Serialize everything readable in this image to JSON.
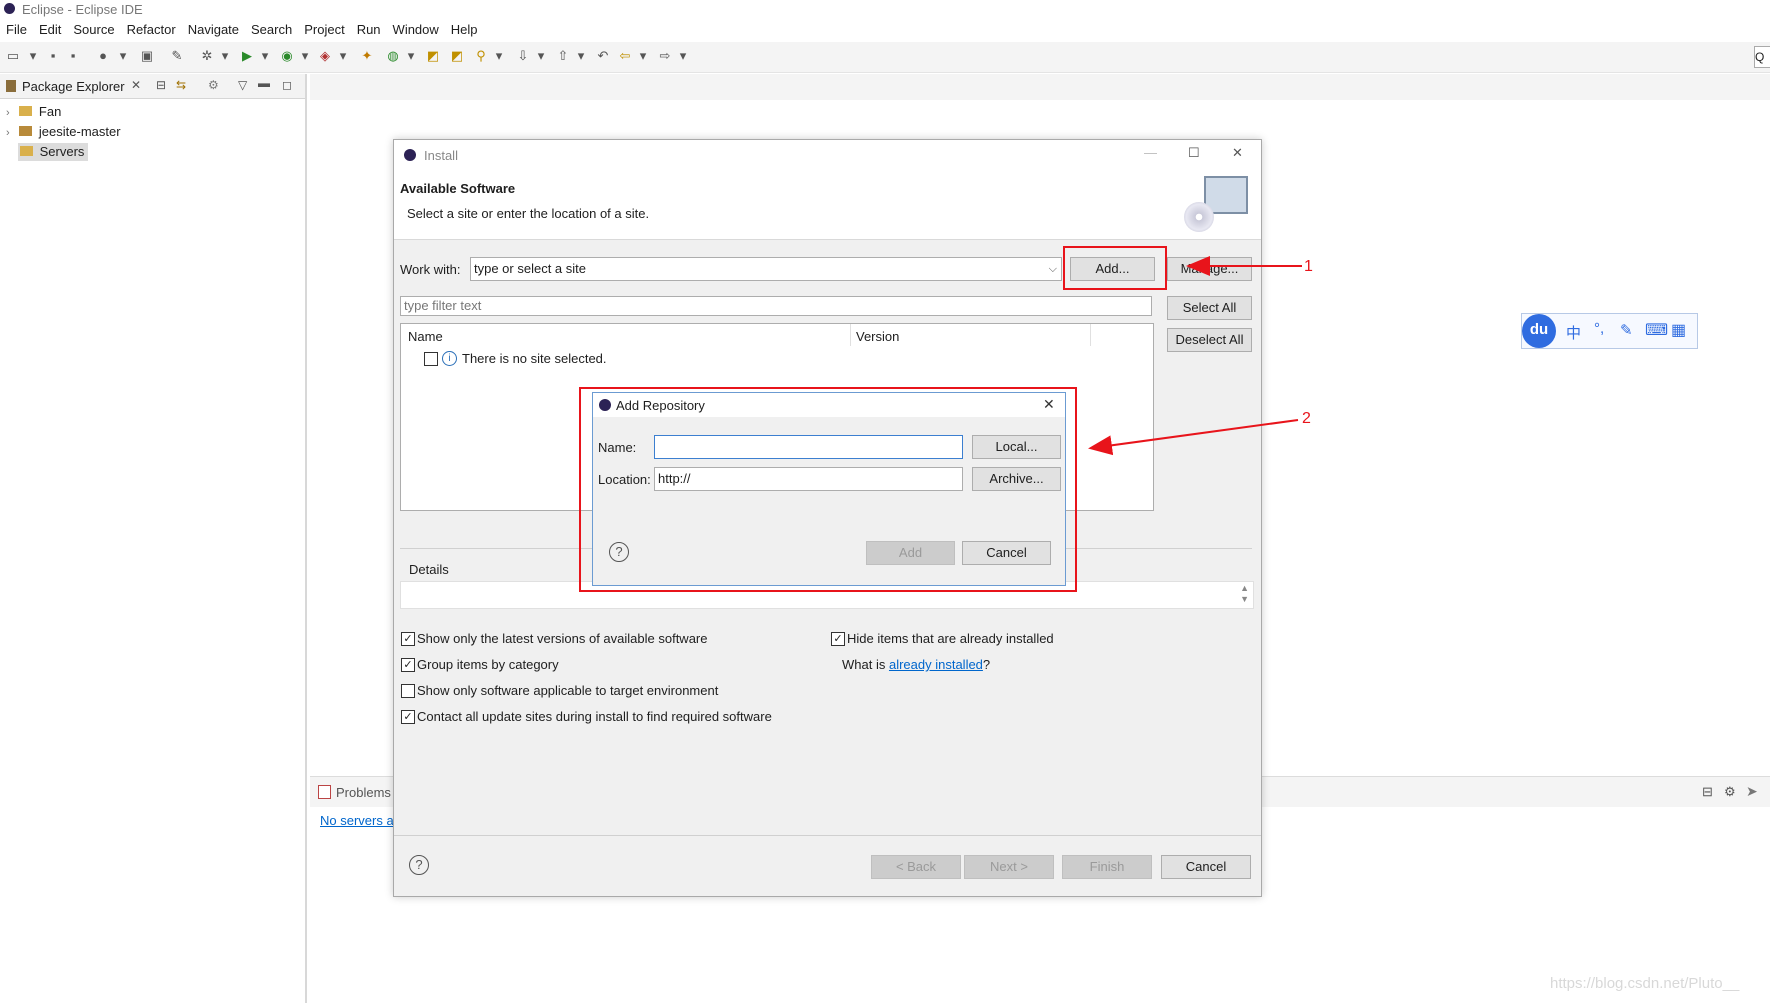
{
  "window": {
    "title": "Eclipse - Eclipse IDE"
  },
  "menu": [
    "File",
    "Edit",
    "Source",
    "Refactor",
    "Navigate",
    "Search",
    "Project",
    "Run",
    "Window",
    "Help"
  ],
  "quick_access": "Q",
  "package_explorer": {
    "tab_label": "Package Explorer",
    "items": [
      "Fan",
      "jeesite-master",
      "Servers"
    ]
  },
  "install": {
    "window_title": "Install",
    "header_title": "Available Software",
    "header_subtitle": "Select a site or enter the location of a site.",
    "work_with_label": "Work with:",
    "work_with_value": "type or select a site",
    "add_button": "Add...",
    "manage_button": "Manage...",
    "filter_placeholder": "type filter text",
    "select_all": "Select All",
    "deselect_all": "Deselect All",
    "col_name": "Name",
    "col_version": "Version",
    "no_site_text": "There is no site selected.",
    "details_label": "Details",
    "options": [
      {
        "label": "Show only the latest versions of available software",
        "checked": true
      },
      {
        "label": "Group items by category",
        "checked": true
      },
      {
        "label": "Show only software applicable to target environment",
        "checked": false
      },
      {
        "label": "Contact all update sites during install to find required software",
        "checked": true
      }
    ],
    "hide_installed": {
      "label": "Hide items that are already installed",
      "checked": true
    },
    "what_is_prefix": "What is ",
    "what_is_link": "already installed",
    "what_is_suffix": "?",
    "back_button": "< Back",
    "next_button": "Next >",
    "finish_button": "Finish",
    "cancel_button": "Cancel"
  },
  "add_repository": {
    "title": "Add Repository",
    "name_label": "Name:",
    "name_value": "",
    "location_label": "Location:",
    "location_value": "http://",
    "local_button": "Local...",
    "archive_button": "Archive...",
    "add_button": "Add",
    "cancel_button": "Cancel"
  },
  "bottom_panel": {
    "problems_tab": "Problems",
    "servers_link": "No servers a"
  },
  "annotations": {
    "label1": "1",
    "label2": "2"
  },
  "ime_toolbar": {
    "logo": "du",
    "items": [
      "中",
      "°,",
      "✎",
      "⌨",
      "▦"
    ]
  },
  "watermark": "https://blog.csdn.net/Pluto__"
}
